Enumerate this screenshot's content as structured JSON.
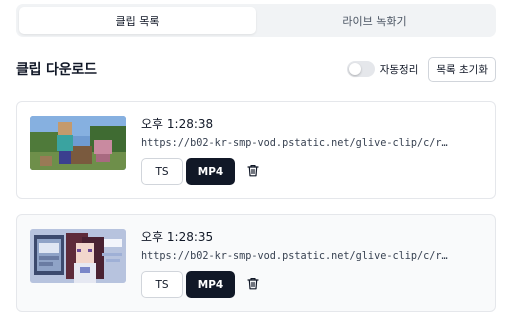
{
  "tabs": [
    {
      "label": "클립 목록",
      "active": true
    },
    {
      "label": "라이브 녹화기",
      "active": false
    }
  ],
  "header": {
    "title": "클립 다운로드",
    "toggle_label": "자동정리",
    "toggle_on": false,
    "reset_label": "목록 초기화"
  },
  "clips": [
    {
      "time": "오후 1:28:38",
      "url": "https://b02-kr-smp-vod.pstatic.net/glive-clip/c/r…",
      "ts_label": "TS",
      "mp4_label": "MP4",
      "thumbnail": "minecraft-gameplay-thumbnail"
    },
    {
      "time": "오후 1:28:35",
      "url": "https://b02-kr-smp-vod.pstatic.net/glive-clip/c/r…",
      "ts_label": "TS",
      "mp4_label": "MP4",
      "thumbnail": "vtuber-stream-thumbnail"
    }
  ],
  "colors": {
    "primary_button": "#111827",
    "tab_background": "#f1f3f5",
    "border": "#e5e7eb"
  },
  "icons": {
    "delete": "trash-icon"
  }
}
